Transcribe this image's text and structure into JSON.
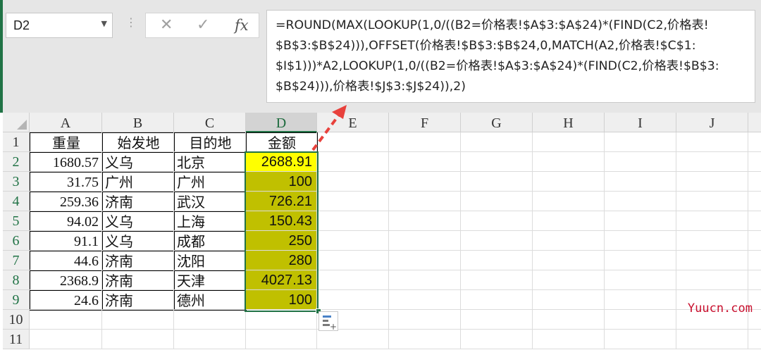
{
  "name_box": {
    "value": "D2"
  },
  "formula_bar": {
    "cancel_glyph": "✕",
    "enter_glyph": "✓",
    "fx_label": "fx",
    "formula": "=ROUND(MAX(LOOKUP(1,0/((B2=价格表!$A$3:$A$24)*(FIND(C2,价格表!\n$B$3:$B$24))),OFFSET(价格表!$B$3:$B$24,0,MATCH(A2,价格表!$C$1:\n$I$1)))*A2,LOOKUP(1,0/((B2=价格表!$A$3:$A$24)*(FIND(C2,价格表!$B$3:\n$B$24))),价格表!$J$3:$J$24)),2)"
  },
  "sheet": {
    "columns": [
      "A",
      "B",
      "C",
      "D",
      "E",
      "F",
      "G",
      "H",
      "I",
      "J"
    ],
    "row_numbers": [
      "1",
      "2",
      "3",
      "4",
      "5",
      "6",
      "7",
      "8",
      "9",
      "10",
      "11"
    ],
    "header": [
      "重量",
      "始发地",
      "目的地",
      "金额"
    ],
    "rows": [
      {
        "weight": "1680.57",
        "origin": "义乌",
        "destination": "北京",
        "amount": "2688.91"
      },
      {
        "weight": "31.75",
        "origin": "广州",
        "destination": "广州",
        "amount": "100"
      },
      {
        "weight": "259.36",
        "origin": "济南",
        "destination": "武汉",
        "amount": "726.21"
      },
      {
        "weight": "94.02",
        "origin": "义乌",
        "destination": "上海",
        "amount": "150.43"
      },
      {
        "weight": "91.1",
        "origin": "义乌",
        "destination": "成都",
        "amount": "250"
      },
      {
        "weight": "44.6",
        "origin": "济南",
        "destination": "沈阳",
        "amount": "280"
      },
      {
        "weight": "2368.9",
        "origin": "济南",
        "destination": "天津",
        "amount": "4027.13"
      },
      {
        "weight": "24.6",
        "origin": "济南",
        "destination": "德州",
        "amount": "100"
      }
    ]
  },
  "colors": {
    "active_cell_fill": "#ffff00",
    "amount_fill": "#c0c000",
    "selection_border": "#217346",
    "arrow": "#e8413c",
    "watermark": "#c8102e"
  },
  "watermark": "Yuucn.com"
}
